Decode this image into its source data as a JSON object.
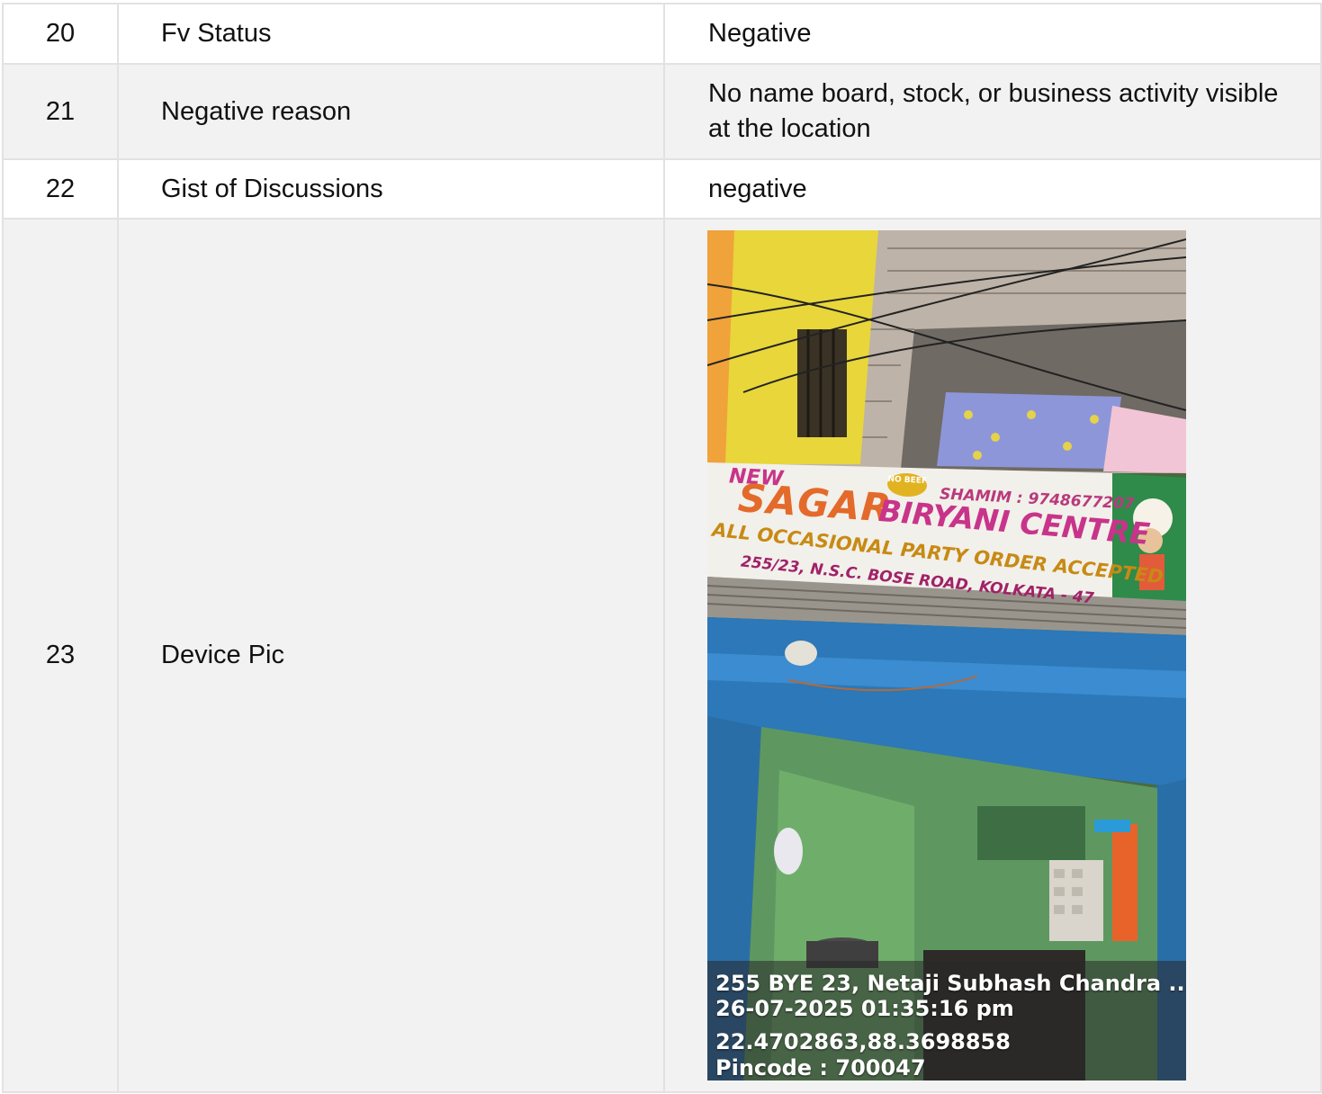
{
  "rows": [
    {
      "no": "20",
      "label": "Fv Status",
      "value": "Negative"
    },
    {
      "no": "21",
      "label": "Negative reason",
      "value": "No name board, stock, or business activity visible at the location"
    },
    {
      "no": "22",
      "label": "Gist of Discussions",
      "value": "negative"
    },
    {
      "no": "23",
      "label": "Device Pic"
    }
  ],
  "device_pic": {
    "sign": {
      "new": "NEW",
      "no_beef": "NO BEEF",
      "contact": "SHAMIM : 9748677207",
      "name_1": "SAGAR",
      "name_2": "BIRYANI CENTRE",
      "tagline": "ALL OCCASIONAL PARTY ORDER ACCEPTED",
      "address": "255/23, N.S.C. BOSE ROAD, KOLKATA - 47"
    },
    "overlay": {
      "address": "255 BYE 23, Netaji Subhash Chandra ...",
      "datetime": "26-07-2025 01:35:16 pm",
      "coordinates": "22.4702863,88.3698858",
      "pincode": "Pincode : 700047"
    }
  },
  "colors": {
    "border": "#e2e2e2",
    "row_alt": "#f2f2f2",
    "text": "#111111"
  }
}
